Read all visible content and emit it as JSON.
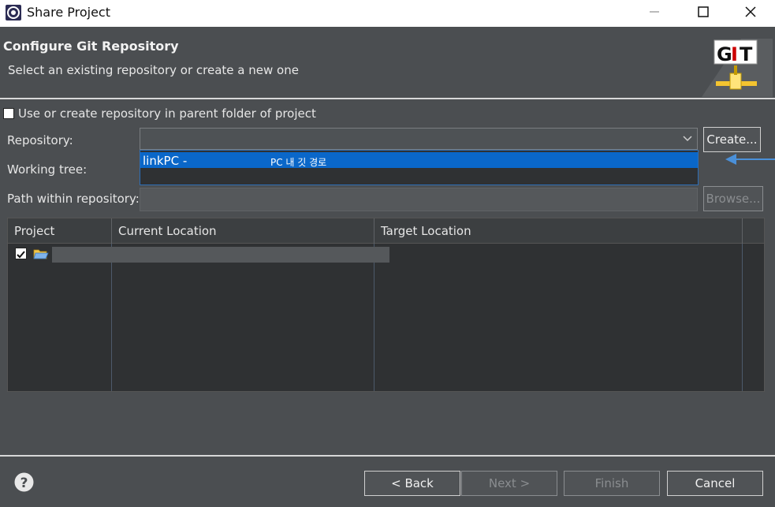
{
  "window": {
    "title": "Share Project",
    "controls": [
      "minimize",
      "maximize",
      "close"
    ]
  },
  "header": {
    "heading": "Configure Git Repository",
    "description": "Select an existing repository or create a new one",
    "logo_text": "GIT"
  },
  "form": {
    "parent_folder_checkbox": {
      "label": "Use or create repository in parent folder of project",
      "checked": false
    },
    "repository_label": "Repository:",
    "repository_value": "",
    "create_button": "Create...",
    "dropdown_options": [
      {
        "name": "linkPC -",
        "path": "PC 내 깃 경로",
        "selected": true
      }
    ],
    "working_tree_label": "Working tree:",
    "path_label": "Path within repository:",
    "browse_button": "Browse..."
  },
  "table": {
    "columns": [
      "Project",
      "Current Location",
      "Target Location"
    ],
    "rows": [
      {
        "checked": true,
        "icon": "folder-open-icon"
      }
    ]
  },
  "footer": {
    "back": "< Back",
    "next": "Next >",
    "finish": "Finish",
    "cancel": "Cancel"
  },
  "colors": {
    "background": "#4b4e51",
    "selection": "#0a67c9",
    "annotation_arrow": "#4a90d9"
  }
}
